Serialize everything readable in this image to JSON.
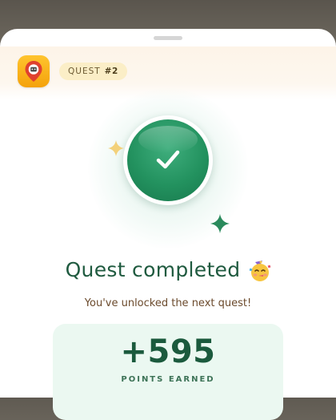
{
  "header": {
    "app_icon": "map-pin-icon",
    "quest_label": "QUEST",
    "quest_number": "#2"
  },
  "hero": {
    "badge_icon": "checkmark-icon",
    "badge_color": "#23925f",
    "sparkle_colors": [
      "#f3d17a",
      "#2a8a5c"
    ]
  },
  "result": {
    "title": "Quest completed",
    "title_emoji": "party-face-emoji",
    "subtitle": "You've unlocked the next quest!"
  },
  "points": {
    "value": "+595",
    "label": "POINTS EARNED"
  }
}
